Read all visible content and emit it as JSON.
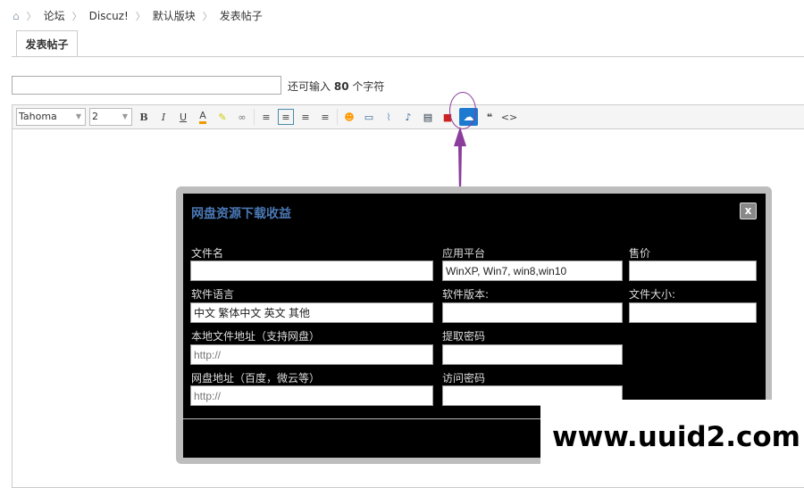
{
  "breadcrumb": [
    "论坛",
    "Discuz!",
    "默认版块",
    "发表帖子"
  ],
  "tab": "发表帖子",
  "title_input": {
    "value": "",
    "remaining_prefix": "还可输入",
    "remaining_count": "80",
    "remaining_suffix": "个字符"
  },
  "toolbar": {
    "font": "Tahoma",
    "size": "2",
    "bold": "B",
    "italic": "I",
    "underline": "U",
    "color": "A",
    "quote": "❝",
    "code": "<>"
  },
  "dialog": {
    "title": "网盘资源下载收益",
    "close": "x",
    "fields": [
      {
        "label": "文件名",
        "value": ""
      },
      {
        "label": "应用平台",
        "value": "WinXP, Win7, win8,win10"
      },
      {
        "label": "售价",
        "value": ""
      },
      {
        "label": "软件语言",
        "value": "中文 繁体中文 英文 其他"
      },
      {
        "label": "软件版本:",
        "value": ""
      },
      {
        "label": "文件大小:",
        "value": ""
      },
      {
        "label": "本地文件地址（支持网盘）",
        "placeholder": "http://"
      },
      {
        "label": "提取密码",
        "value": ""
      },
      {
        "label": "网盘地址（百度，微云等）",
        "placeholder": "http://"
      },
      {
        "label": "访问密码",
        "value": ""
      }
    ]
  },
  "watermark": "www.uuid2.com",
  "colors": {
    "dialog_title": "#4a78b5",
    "cloud_button": "#1e7ad1",
    "annotation": "#8a3d9a"
  }
}
